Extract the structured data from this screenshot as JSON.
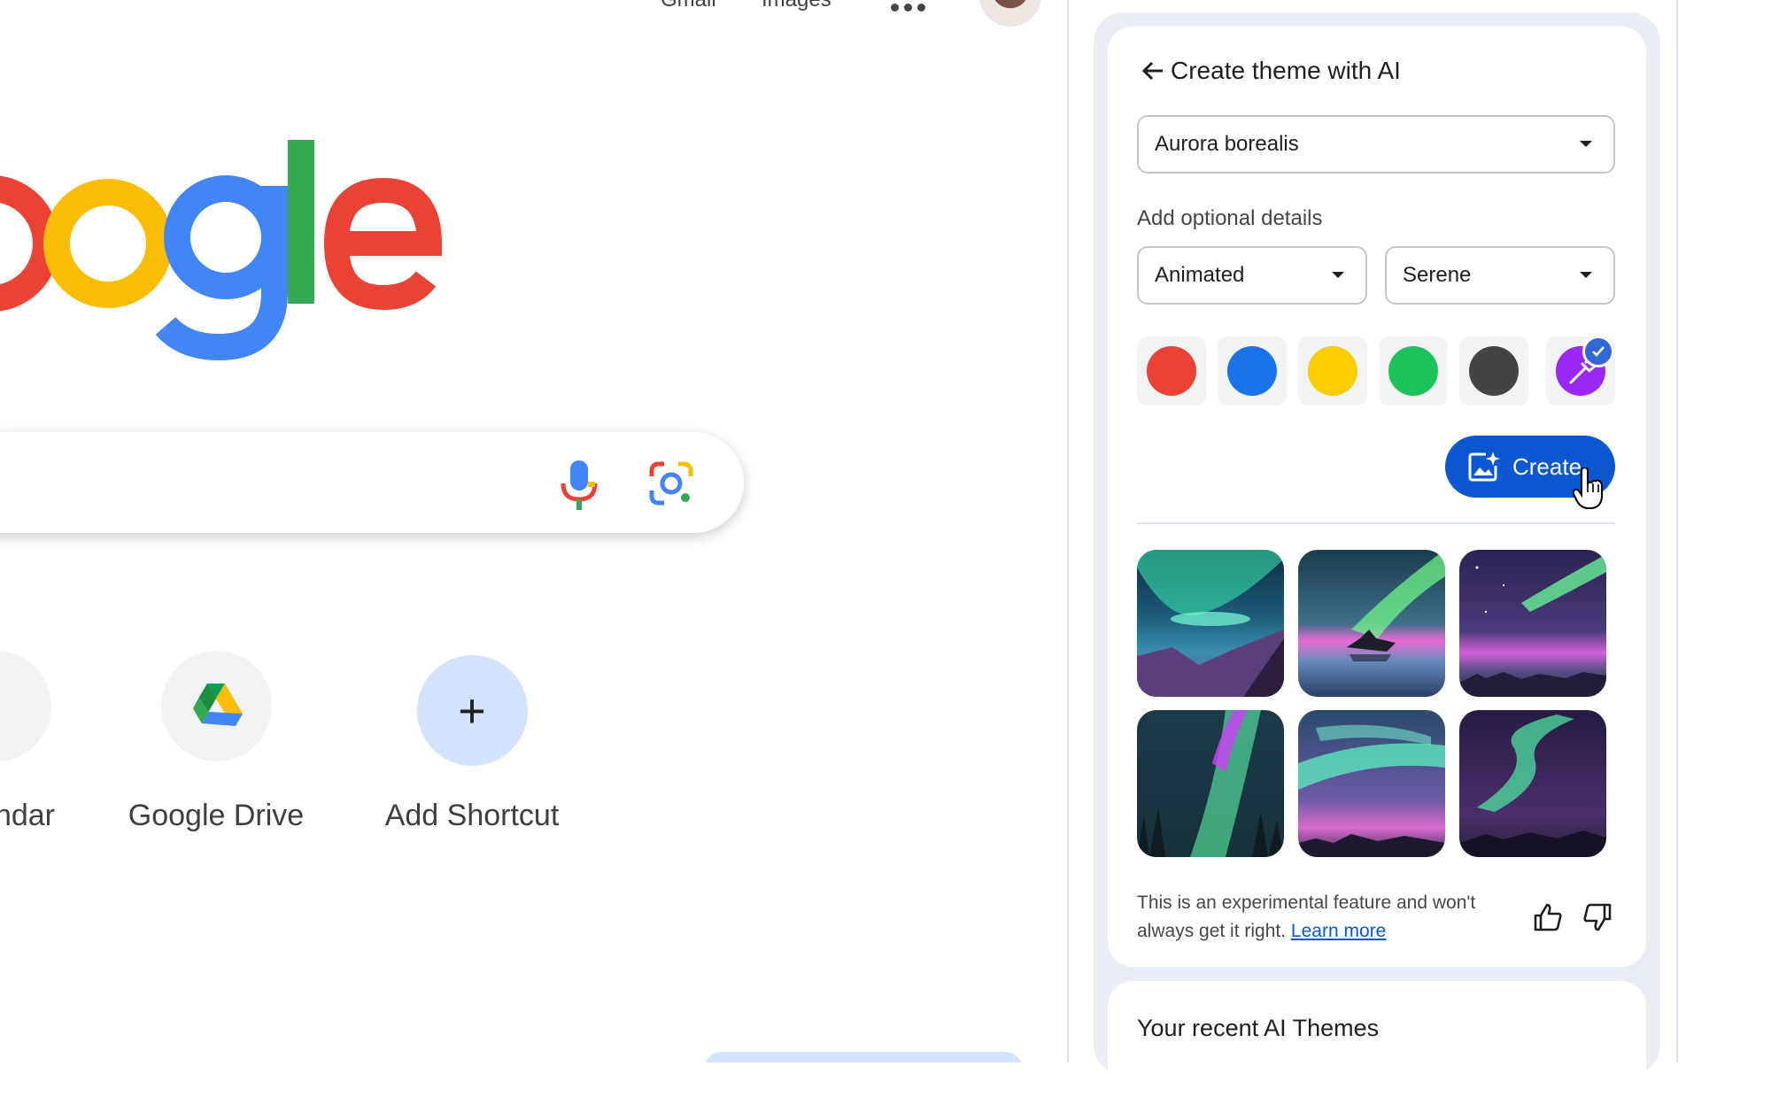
{
  "header": {
    "links": [
      "Gmail",
      "Images"
    ],
    "apps_icon": "dots-icon",
    "account_icon": "avatar"
  },
  "search": {
    "mic_icon": "mic-icon",
    "lens_icon": "lens-icon"
  },
  "shortcuts": [
    {
      "label": "ndar",
      "icon": "calendar-icon"
    },
    {
      "label": "Google Drive",
      "icon": "drive-icon"
    },
    {
      "label": "Add Shortcut",
      "icon": "plus-icon",
      "glyph": "+"
    }
  ],
  "panel": {
    "title": "Create theme with AI",
    "subject_select": "Aurora borealis",
    "optional_label": "Add optional details",
    "style_select": "Animated",
    "mood_select": "Serene",
    "colors": [
      {
        "name": "red",
        "hex": "#ea4335"
      },
      {
        "name": "blue",
        "hex": "#1a73e8"
      },
      {
        "name": "yellow",
        "hex": "#fbcc00"
      },
      {
        "name": "green",
        "hex": "#1ec25d"
      },
      {
        "name": "dark-gray",
        "hex": "#444444"
      },
      {
        "name": "custom-purple",
        "hex": "#9b27f5",
        "selected": true
      }
    ],
    "create_label": "Create",
    "disclaimer_text": "This is an experimental feature and won't always get it right.",
    "learn_more": "Learn more",
    "recent_title": "Your recent AI Themes"
  },
  "colors": {
    "accent": "#0b57d0",
    "panel_bg": "#e9eef6"
  }
}
